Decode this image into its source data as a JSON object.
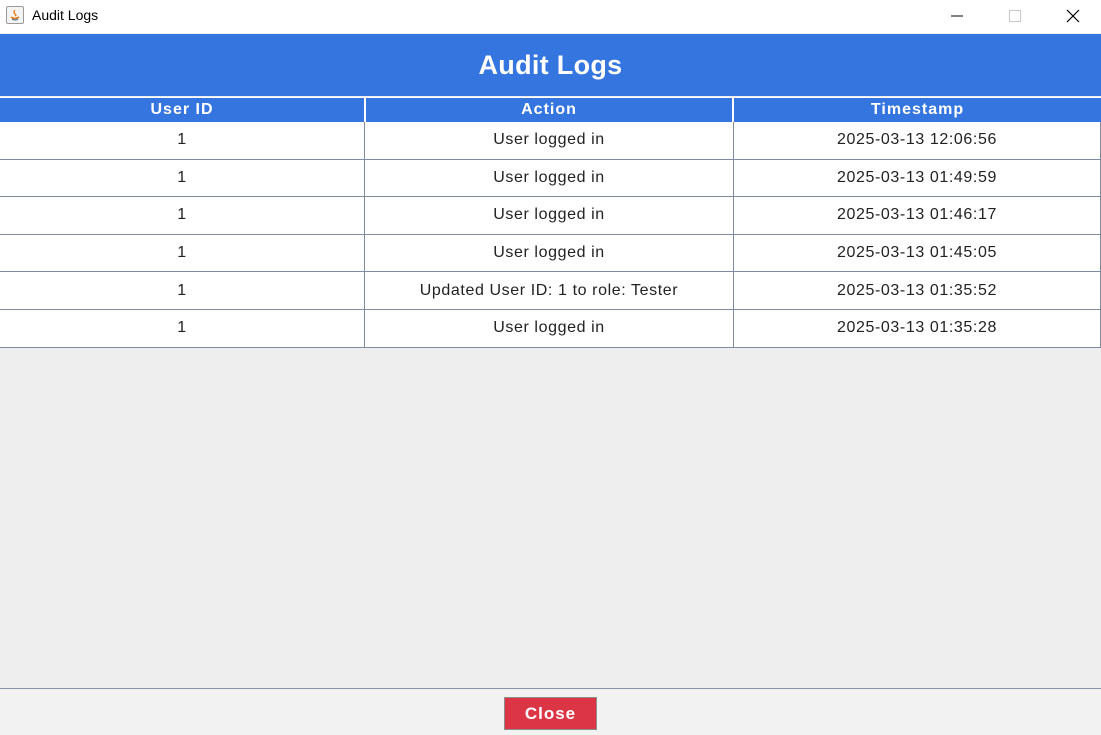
{
  "window": {
    "title": "Audit Logs",
    "controls": [
      "minimize-icon",
      "maximize-icon",
      "close-icon"
    ]
  },
  "header": {
    "title": "Audit Logs"
  },
  "table": {
    "columns": [
      "User ID",
      "Action",
      "Timestamp"
    ],
    "rows": [
      [
        "1",
        "User logged in",
        "2025-03-13 12:06:56"
      ],
      [
        "1",
        "User logged in",
        "2025-03-13 01:49:59"
      ],
      [
        "1",
        "User logged in",
        "2025-03-13 01:46:17"
      ],
      [
        "1",
        "User logged in",
        "2025-03-13 01:45:05"
      ],
      [
        "1",
        "Updated User ID: 1 to role: Tester",
        "2025-03-13 01:35:52"
      ],
      [
        "1",
        "User logged in",
        "2025-03-13 01:35:28"
      ]
    ]
  },
  "footer": {
    "close_label": "Close"
  },
  "colors": {
    "accent": "#3575df",
    "close_button": "#dc3545",
    "background": "#eeeeee"
  }
}
